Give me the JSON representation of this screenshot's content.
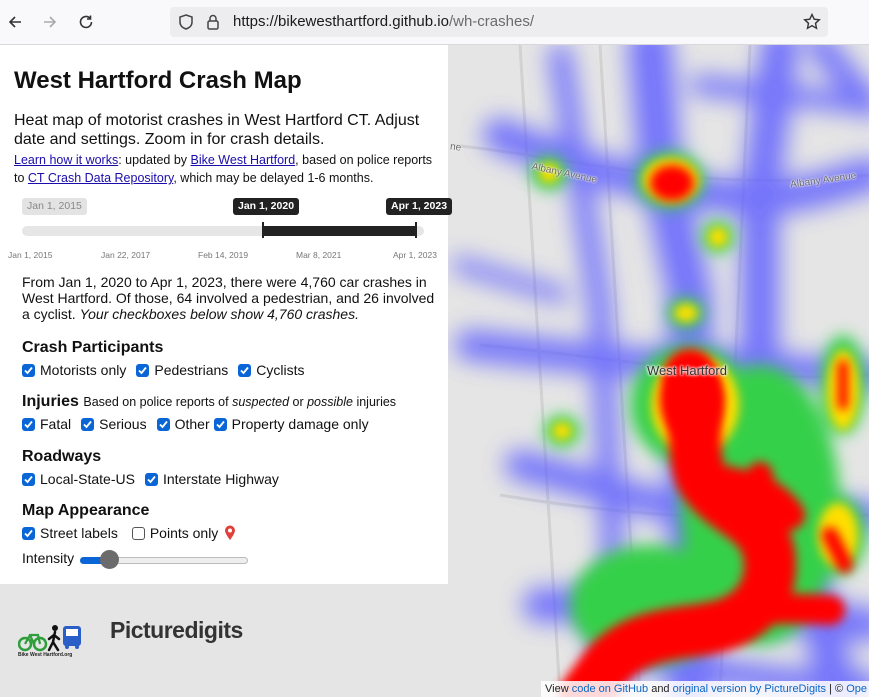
{
  "browser": {
    "url_host": "https://bikewesthartford.github.io",
    "url_path": "/wh-crashes/"
  },
  "panel": {
    "title": "West Hartford Crash Map",
    "subtitle": "Heat map of motorist crashes in West Hartford CT. Adjust date and settings. Zoom in for crash details.",
    "credits": {
      "learn_link": "Learn how it works",
      "text1": ": updated by ",
      "bwh_link": "Bike West Hartford",
      "text2": ", based on police reports to ",
      "repo_link": "CT Crash Data Repository",
      "text3": ", which may be delayed 1-6 months."
    },
    "date_slider": {
      "min_label": "Jan 1, 2015",
      "start_label": "Jan 1, 2020",
      "end_label": "Apr 1, 2023",
      "ticks": [
        "Jan 1, 2015",
        "Jan 22, 2017",
        "Feb 14, 2019",
        "Mar 8, 2021",
        "Apr 1, 2023"
      ]
    },
    "summary": {
      "main": "From Jan 1, 2020 to Apr 1, 2023, there were 4,760 car crashes in West Hartford. Of those, 64 involved a pedestrian, and 26 involved a cyclist.",
      "note": "Your checkboxes below show 4,760 crashes."
    },
    "participants": {
      "heading": "Crash Participants",
      "options": [
        {
          "label": "Motorists only",
          "checked": true
        },
        {
          "label": "Pedestrians",
          "checked": true
        },
        {
          "label": "Cyclists",
          "checked": true
        }
      ]
    },
    "injuries": {
      "heading": "Injuries",
      "note_pre": "Based on police reports of ",
      "note_em1": "suspected",
      "note_mid": " or ",
      "note_em2": "possible",
      "note_post": " injuries",
      "options": [
        {
          "label": "Fatal",
          "checked": true
        },
        {
          "label": "Serious",
          "checked": true
        },
        {
          "label": "Other",
          "checked": true
        },
        {
          "label": "Property damage only",
          "checked": true
        }
      ]
    },
    "roadways": {
      "heading": "Roadways",
      "options": [
        {
          "label": "Local-State-US",
          "checked": true
        },
        {
          "label": "Interstate Highway",
          "checked": true
        }
      ]
    },
    "appearance": {
      "heading": "Map Appearance",
      "street_labels": {
        "label": "Street labels",
        "checked": true
      },
      "points_only": {
        "label": "Points only",
        "checked": false,
        "icon": "map-pin-icon"
      },
      "intensity_label": "Intensity",
      "intensity_value": 0.15
    }
  },
  "map": {
    "town_label": "West Hartford",
    "street_labels": [
      "Albany Avenue",
      "Albany Avenue",
      "ne"
    ]
  },
  "logos": {
    "bwh_text": "Bike West Hartford.org",
    "picturedigits": "Picturedigits"
  },
  "attribution": {
    "view": "View ",
    "code_link": "code on GitHub",
    "and": " and ",
    "original_link": "original version by PictureDigits",
    "sep": " | © ",
    "osm": "Ope"
  },
  "colors": {
    "accent": "#0a66d6",
    "heat_red": "#ff0000",
    "heat_blue": "#5a5aff"
  }
}
